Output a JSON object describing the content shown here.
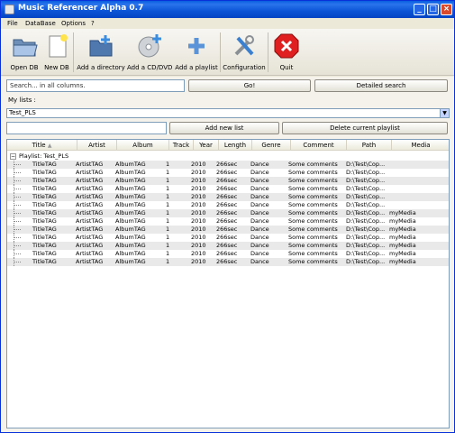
{
  "window": {
    "title": "Music Referencer Alpha 0.7"
  },
  "menu": [
    "File",
    "DataBase",
    "Options",
    "?"
  ],
  "toolbar": [
    {
      "label": "Open DB",
      "icon": "open-folder-icon"
    },
    {
      "label": "New DB",
      "icon": "new-document-icon"
    },
    {
      "label": "Add a directory",
      "icon": "add-folder-icon"
    },
    {
      "label": "Add a CD/DVD",
      "icon": "add-cd-icon"
    },
    {
      "label": "Add a playlist",
      "icon": "plus-icon"
    },
    {
      "label": "Configuration",
      "icon": "tools-icon"
    },
    {
      "label": "Quit",
      "icon": "quit-icon"
    }
  ],
  "search": {
    "placeholder": "Search... in all columns.",
    "go_label": "Go!",
    "detailed_label": "Detailed search"
  },
  "lists": {
    "label": "My lists :",
    "selected": "Test_PLS"
  },
  "playlist": {
    "new_value": "",
    "add_label": "Add new list",
    "delete_label": "Delete current playlist"
  },
  "table": {
    "columns": [
      "Title",
      "Artist",
      "Album",
      "Track",
      "Year",
      "Length",
      "Genre",
      "Comment",
      "Path",
      "Media"
    ],
    "group": "Playlist: Test_PLS",
    "rows": [
      [
        "TitleTAG",
        "ArtistTAG",
        "AlbumTAG",
        "1",
        "2010",
        "266sec",
        "Dance",
        "Some comments",
        "D:\\Test\\Cop...",
        ""
      ],
      [
        "TitleTAG",
        "ArtistTAG",
        "AlbumTAG",
        "1",
        "2010",
        "266sec",
        "Dance",
        "Some comments",
        "D:\\Test\\Cop...",
        ""
      ],
      [
        "TitleTAG",
        "ArtistTAG",
        "AlbumTAG",
        "1",
        "2010",
        "266sec",
        "Dance",
        "Some comments",
        "D:\\Test\\Cop...",
        ""
      ],
      [
        "TitleTAG",
        "ArtistTAG",
        "AlbumTAG",
        "1",
        "2010",
        "266sec",
        "Dance",
        "Some comments",
        "D:\\Test\\Cop...",
        ""
      ],
      [
        "TitleTAG",
        "ArtistTAG",
        "AlbumTAG",
        "1",
        "2010",
        "266sec",
        "Dance",
        "Some comments",
        "D:\\Test\\Cop...",
        ""
      ],
      [
        "TitleTAG",
        "ArtistTAG",
        "AlbumTAG",
        "1",
        "2010",
        "266sec",
        "Dance",
        "Some comments",
        "D:\\Test\\Cop...",
        ""
      ],
      [
        "TitleTAG",
        "ArtistTAG",
        "AlbumTAG",
        "1",
        "2010",
        "266sec",
        "Dance",
        "Some comments",
        "D:\\Test\\Cop...",
        "myMedia"
      ],
      [
        "TitleTAG",
        "ArtistTAG",
        "AlbumTAG",
        "1",
        "2010",
        "266sec",
        "Dance",
        "Some comments",
        "D:\\Test\\Cop...",
        "myMedia"
      ],
      [
        "TitleTAG",
        "ArtistTAG",
        "AlbumTAG",
        "1",
        "2010",
        "266sec",
        "Dance",
        "Some comments",
        "D:\\Test\\Cop...",
        "myMedia"
      ],
      [
        "TitleTAG",
        "ArtistTAG",
        "AlbumTAG",
        "1",
        "2010",
        "266sec",
        "Dance",
        "Some comments",
        "D:\\Test\\Cop...",
        "myMedia"
      ],
      [
        "TitleTAG",
        "ArtistTAG",
        "AlbumTAG",
        "1",
        "2010",
        "266sec",
        "Dance",
        "Some comments",
        "D:\\Test\\Cop...",
        "myMedia"
      ],
      [
        "TitleTAG",
        "ArtistTAG",
        "AlbumTAG",
        "1",
        "2010",
        "266sec",
        "Dance",
        "Some comments",
        "D:\\Test\\Cop...",
        "myMedia"
      ],
      [
        "TitleTAG",
        "ArtistTAG",
        "AlbumTAG",
        "1",
        "2010",
        "266sec",
        "Dance",
        "Some comments",
        "D:\\Test\\Cop...",
        "myMedia"
      ]
    ]
  }
}
